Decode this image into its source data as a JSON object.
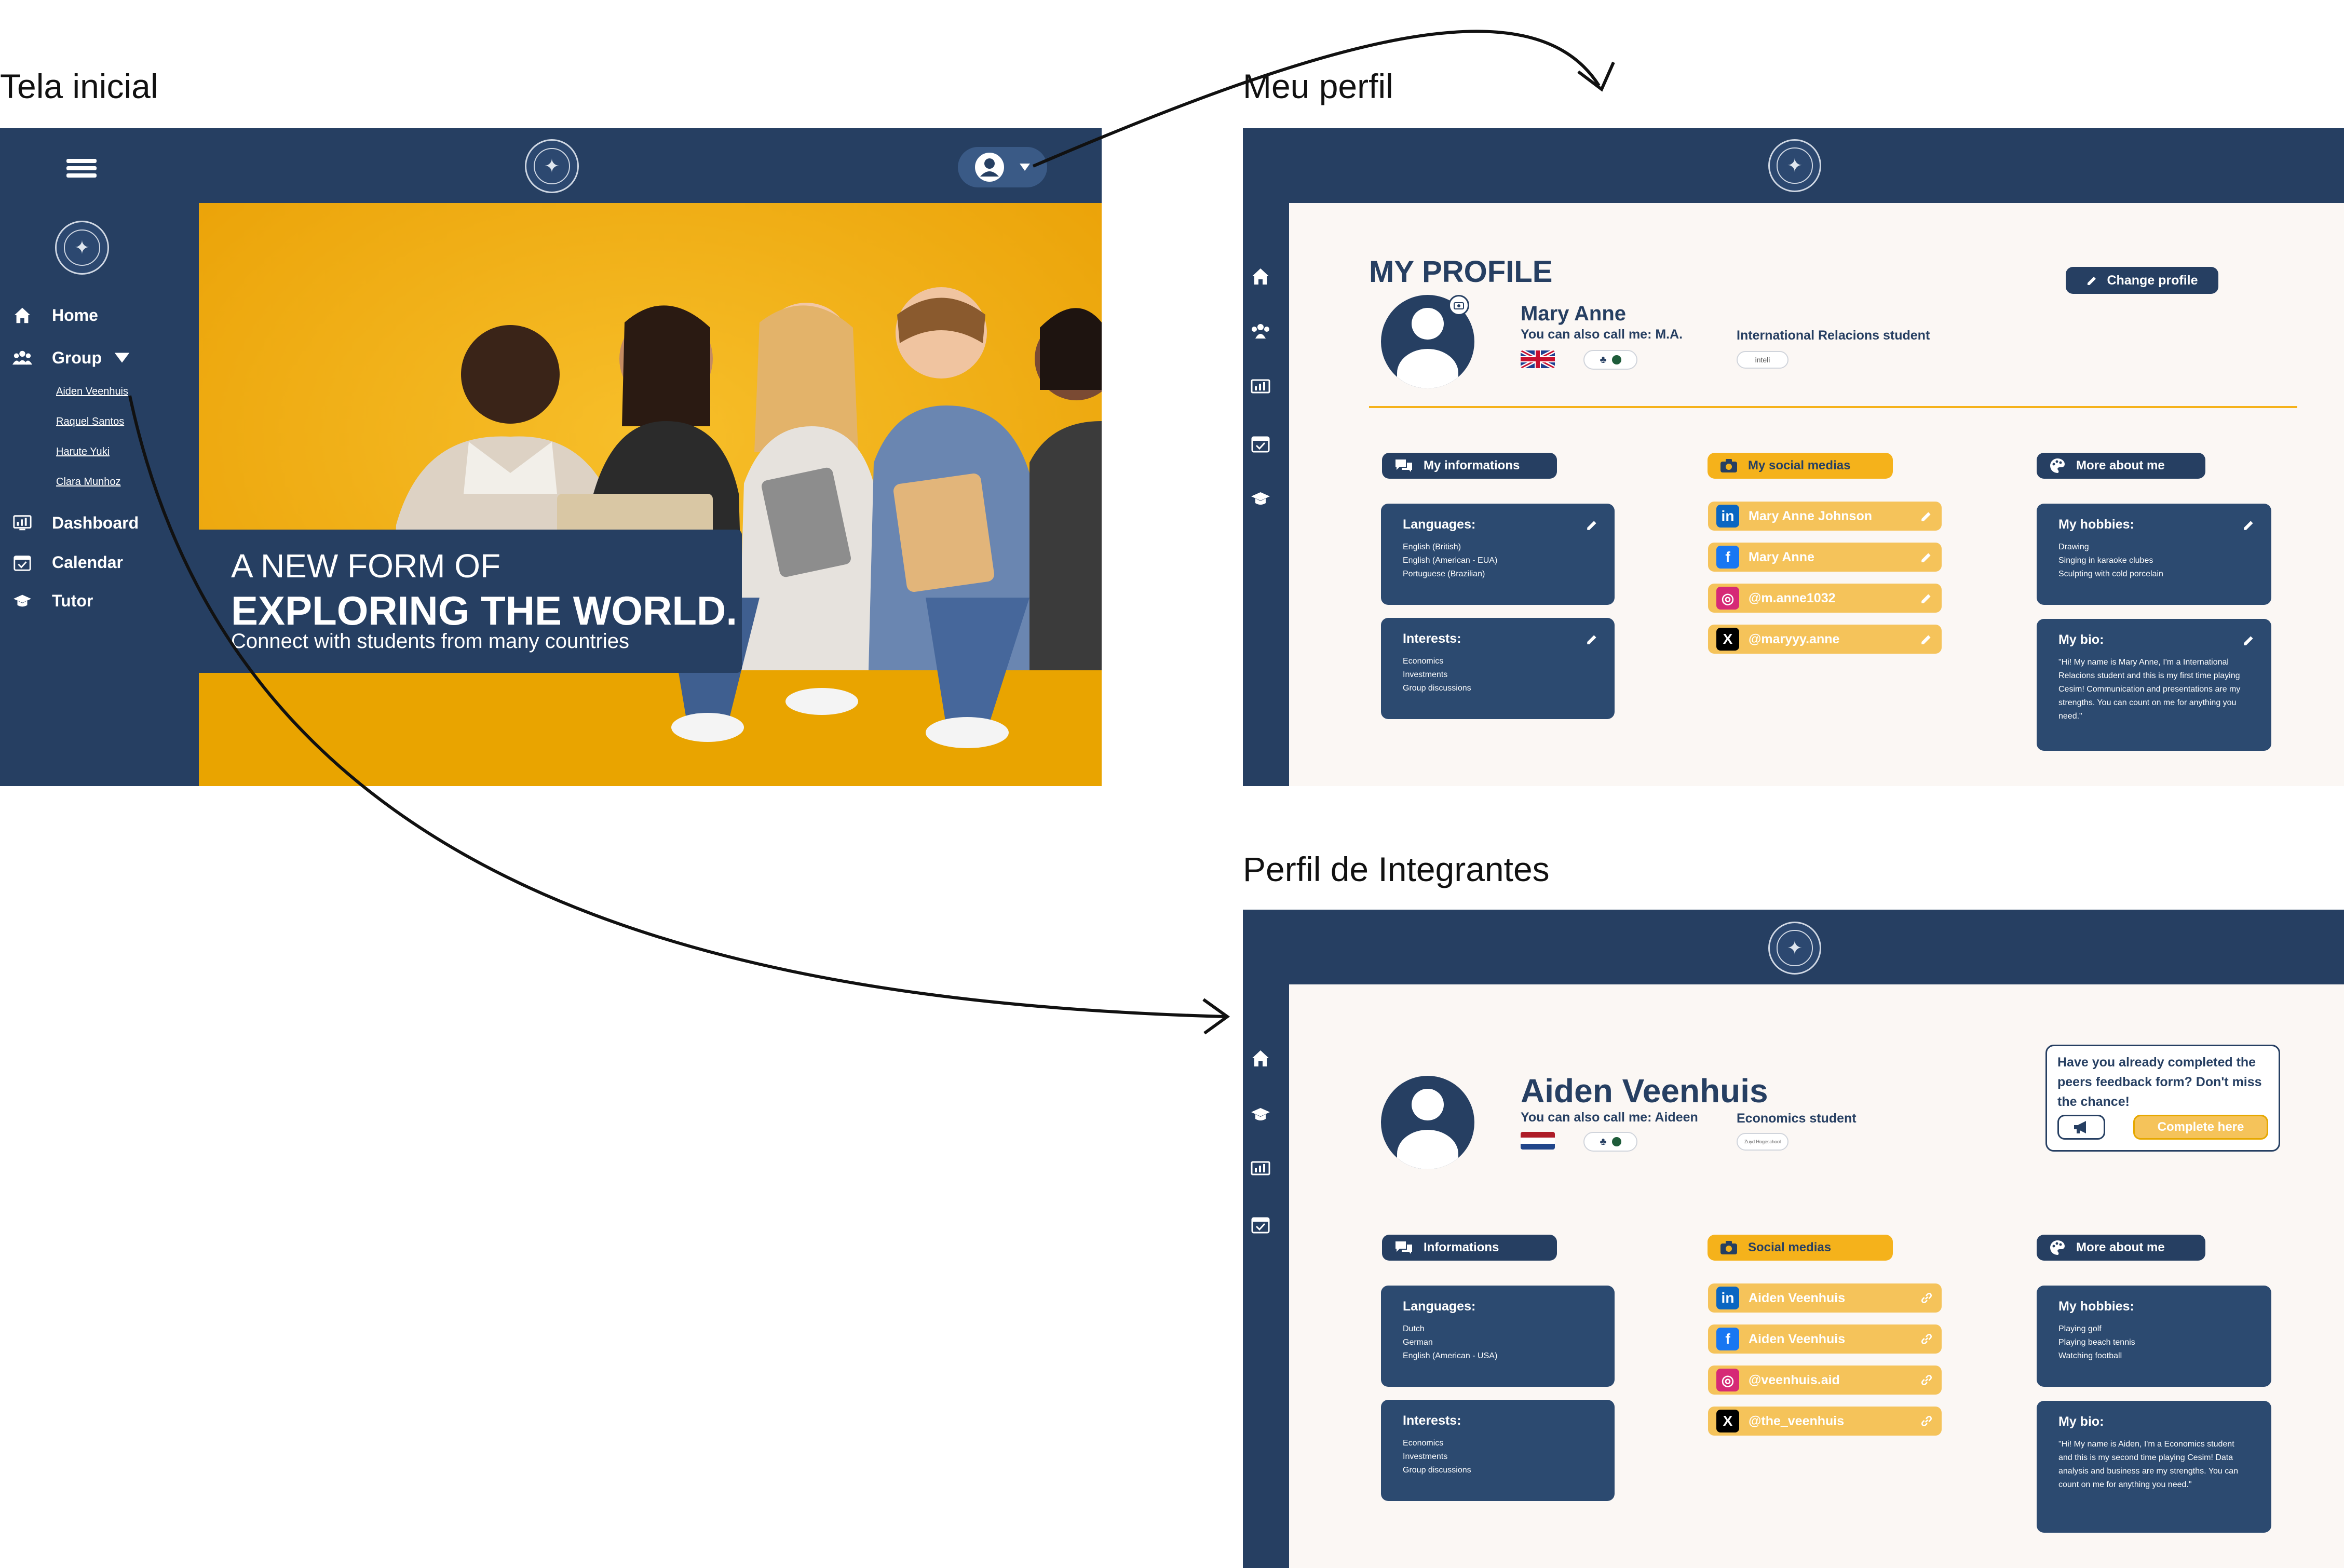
{
  "labels": {
    "home": "Tela inicial",
    "my_profile": "Meu perfil",
    "members_profile": "Perfil de Integrantes"
  },
  "home": {
    "menu": [
      {
        "label": "Home",
        "icon": "home-icon"
      },
      {
        "label": "Group",
        "icon": "group-icon"
      },
      {
        "label": "Dashboard",
        "icon": "dashboard-icon"
      },
      {
        "label": "Calendar",
        "icon": "calendar-icon"
      },
      {
        "label": "Tutor",
        "icon": "graduation-cap-icon"
      }
    ],
    "group_members": [
      "Aiden Veenhuis",
      "Raquel Santos",
      "Harute Yuki",
      "Clara Munhoz"
    ],
    "hero": {
      "line1": "A NEW FORM OF",
      "line2": "EXPLORING THE WORLD.",
      "subtitle": "Connect with students from many countries"
    }
  },
  "my_profile": {
    "title": "MY PROFILE",
    "change_profile": "Change profile",
    "name": "Mary Anne",
    "nickname": "You can also call me: M.A.",
    "role": "International Relacions student",
    "role_badge": "inteli",
    "sections": {
      "info": "My informations",
      "social": "My social medias",
      "more": "More about me"
    },
    "languages_title": "Languages:",
    "languages": [
      "English (British)",
      "English (American - EUA)",
      "Portuguese (Brazilian)"
    ],
    "interests_title": "Interests:",
    "interests": [
      "Economics",
      "Investments",
      "Group discussions"
    ],
    "socials": [
      {
        "label": "Mary Anne Johnson",
        "icon": "linkedin-icon"
      },
      {
        "label": "Mary Anne",
        "icon": "facebook-icon"
      },
      {
        "label": "@m.anne1032",
        "icon": "instagram-icon"
      },
      {
        "label": "@maryyy.anne",
        "icon": "x-icon"
      }
    ],
    "hobbies_title": "My hobbies:",
    "hobbies": [
      "Drawing",
      "Singing in karaoke clubes",
      "Sculpting with cold porcelain"
    ],
    "bio_title": "My bio:",
    "bio": "\"Hi! My name is Mary Anne, I'm a International Relacions student and this is my first time playing Cesim! Communication and presentations are my strengths. You can count on me for anything you need.\""
  },
  "member_profile": {
    "name": "Aiden Veenhuis",
    "nickname": "You can also call me: Aideen",
    "role": "Economics student",
    "role_badge": "Zuyd Hogeschool",
    "feedback_text": "Have you already completed the peers feedback form? Don't miss the chance!",
    "feedback_button": "Complete here",
    "sections": {
      "info": "Informations",
      "social": "Social medias",
      "more": "More about me"
    },
    "languages_title": "Languages:",
    "languages": [
      "Dutch",
      "German",
      "English (American - USA)"
    ],
    "interests_title": "Interests:",
    "interests": [
      "Economics",
      "Investments",
      "Group discussions"
    ],
    "socials": [
      {
        "label": "Aiden Veenhuis",
        "icon": "linkedin-icon"
      },
      {
        "label": "Aiden Veenhuis",
        "icon": "facebook-icon"
      },
      {
        "label": "@veenhuis.aid",
        "icon": "instagram-icon"
      },
      {
        "label": "@the_veenhuis",
        "icon": "x-icon"
      }
    ],
    "hobbies_title": "My hobbies:",
    "hobbies": [
      "Playing golf",
      "Playing beach tennis",
      "Watching football"
    ],
    "bio_title": "My bio:",
    "bio": "\"Hi! My name is Aiden, I'm a Economics student and this is my second time playing Cesim! Data analysis and business are my strengths. You can count on me for anything you need.\""
  },
  "colors": {
    "navy": "#263f62",
    "card": "#2c4a70",
    "gold": "#f5b21b",
    "gold_light": "#f5c35a",
    "hero_bg": "#f3b214",
    "body_bg": "#fbf7f4"
  }
}
